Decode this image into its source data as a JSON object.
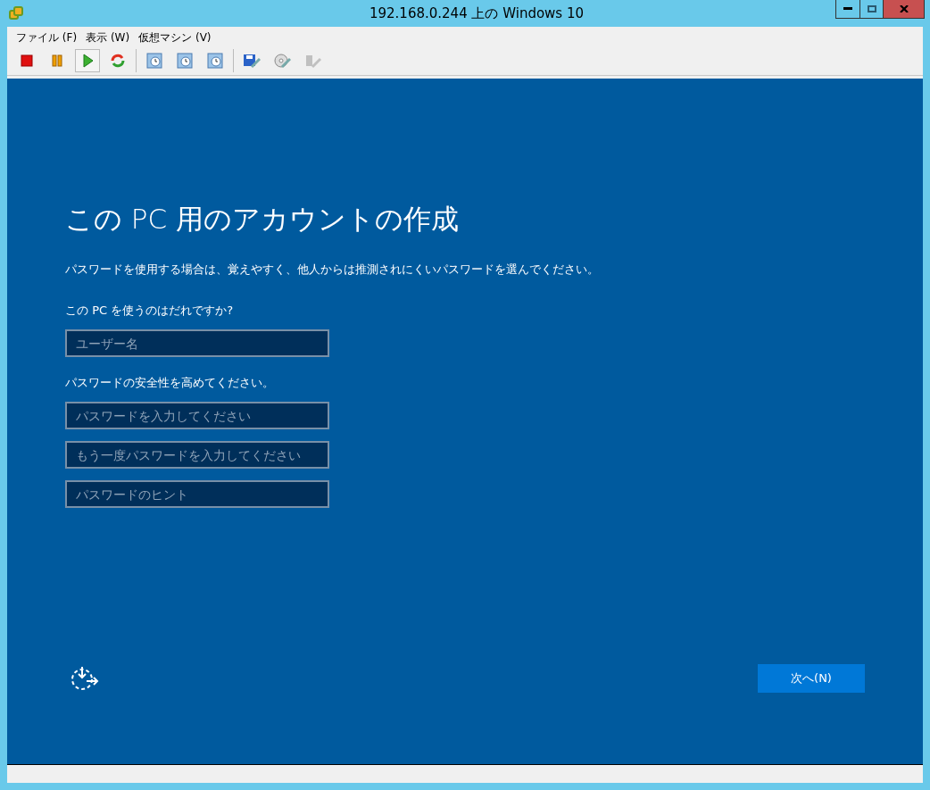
{
  "window": {
    "title": "192.168.0.244 上の Windows 10"
  },
  "menu": [
    {
      "label": "ファイル (F)"
    },
    {
      "label": "表示 (W)"
    },
    {
      "label": "仮想マシン (V)"
    }
  ],
  "toolbar": [
    {
      "kind": "stop",
      "selected": false,
      "disabled": false
    },
    {
      "kind": "pause",
      "selected": false,
      "disabled": false
    },
    {
      "kind": "play",
      "selected": true,
      "disabled": false
    },
    {
      "kind": "reset",
      "selected": false,
      "disabled": false
    },
    {
      "kind": "snapshot",
      "selected": false,
      "disabled": false
    },
    {
      "kind": "revert",
      "selected": false,
      "disabled": false
    },
    {
      "kind": "manage",
      "selected": false,
      "disabled": false
    },
    {
      "kind": "floppy",
      "selected": false,
      "disabled": false
    },
    {
      "kind": "cd",
      "selected": false,
      "disabled": false
    },
    {
      "kind": "usb",
      "selected": false,
      "disabled": true
    }
  ],
  "setup": {
    "heading": "この PC 用のアカウントの作成",
    "intro": "パスワードを使用する場合は、覚えやすく、他人からは推測されにくいパスワードを選んでください。",
    "user_prompt": "この PC を使うのはだれですか?",
    "username": {
      "placeholder": "ユーザー名"
    },
    "password_prompt": "パスワードの安全性を高めてください。",
    "password_fields": [
      {
        "placeholder": "パスワードを入力してください"
      },
      {
        "placeholder": "もう一度パスワードを入力してください"
      },
      {
        "placeholder": "パスワードのヒント"
      }
    ],
    "next_button": "次へ(N)"
  }
}
